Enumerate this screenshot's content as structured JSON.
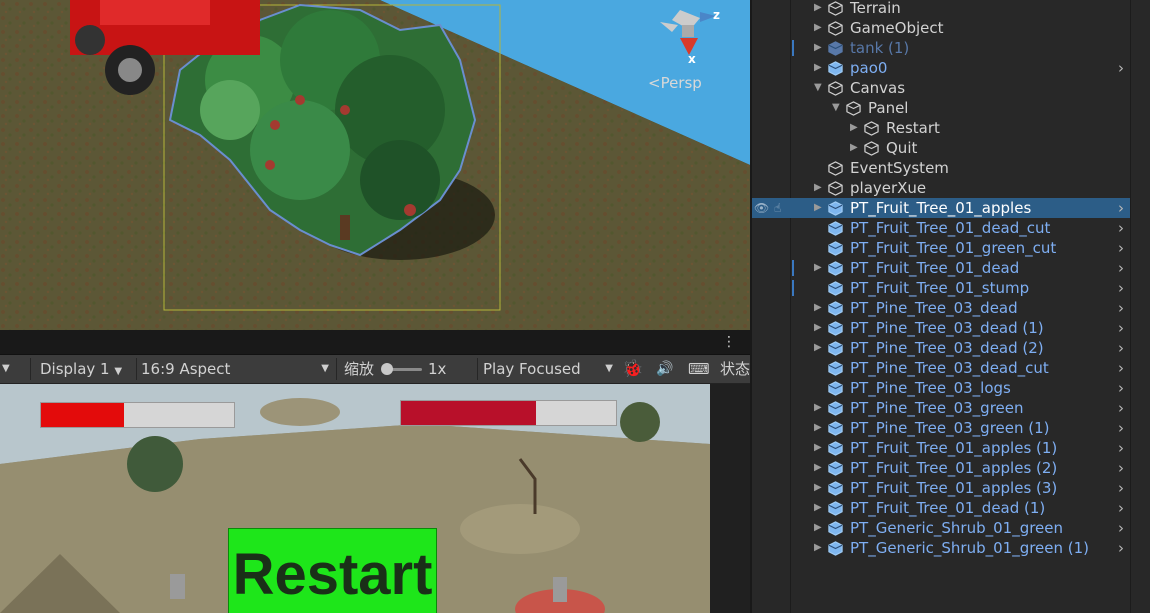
{
  "scene": {
    "view_label": "<Persp",
    "gizmo_x": "x",
    "gizmo_z": "z"
  },
  "game_toolbar": {
    "display": "Display 1",
    "aspect": "16:9 Aspect",
    "scale_label": "缩放",
    "scale_value": "1x",
    "play_mode": "Play Focused",
    "stats_label": "状态"
  },
  "game_view": {
    "restart_label": "Restart",
    "health_left_fraction": 0.43,
    "health_right_fraction": 0.63,
    "health_left_color": "#e30b0b",
    "health_right_color": "#b8102a"
  },
  "hierarchy": {
    "rows": [
      {
        "label": "Terrain",
        "style": "normal",
        "arrow": "right"
      },
      {
        "label": "GameObject",
        "style": "normal",
        "arrow": "right"
      },
      {
        "label": "tank (1)",
        "style": "dim",
        "arrow": "right"
      },
      {
        "label": "pao0",
        "style": "blue",
        "arrow": "right"
      },
      {
        "label": "Canvas",
        "style": "normal",
        "arrow": "down"
      },
      {
        "label": "Panel",
        "style": "normal",
        "arrow": "down"
      },
      {
        "label": "Restart",
        "style": "normal",
        "arrow": "right"
      },
      {
        "label": "Quit",
        "style": "normal",
        "arrow": "right"
      },
      {
        "label": "EventSystem",
        "style": "normal",
        "arrow": "none"
      },
      {
        "label": "playerXue",
        "style": "normal",
        "arrow": "right"
      },
      {
        "label": "PT_Fruit_Tree_01_apples",
        "style": "selected",
        "arrow": "right"
      },
      {
        "label": "PT_Fruit_Tree_01_dead_cut",
        "style": "blue",
        "arrow": "none"
      },
      {
        "label": "PT_Fruit_Tree_01_green_cut",
        "style": "blue",
        "arrow": "none"
      },
      {
        "label": "PT_Fruit_Tree_01_dead",
        "style": "blue",
        "arrow": "right"
      },
      {
        "label": "PT_Fruit_Tree_01_stump",
        "style": "blue",
        "arrow": "none"
      },
      {
        "label": "PT_Pine_Tree_03_dead",
        "style": "blue",
        "arrow": "right"
      },
      {
        "label": "PT_Pine_Tree_03_dead (1)",
        "style": "blue",
        "arrow": "right"
      },
      {
        "label": "PT_Pine_Tree_03_dead (2)",
        "style": "blue",
        "arrow": "right"
      },
      {
        "label": "PT_Pine_Tree_03_dead_cut",
        "style": "blue",
        "arrow": "none"
      },
      {
        "label": "PT_Pine_Tree_03_logs",
        "style": "blue",
        "arrow": "none"
      },
      {
        "label": "PT_Pine_Tree_03_green",
        "style": "blue",
        "arrow": "right"
      },
      {
        "label": "PT_Pine_Tree_03_green (1)",
        "style": "blue",
        "arrow": "right"
      },
      {
        "label": "PT_Fruit_Tree_01_apples (1)",
        "style": "blue",
        "arrow": "right"
      },
      {
        "label": "PT_Fruit_Tree_01_apples (2)",
        "style": "blue",
        "arrow": "right"
      },
      {
        "label": "PT_Fruit_Tree_01_apples (3)",
        "style": "blue",
        "arrow": "right"
      },
      {
        "label": "PT_Fruit_Tree_01_dead (1)",
        "style": "blue",
        "arrow": "right"
      },
      {
        "label": "PT_Generic_Shrub_01_green",
        "style": "blue",
        "arrow": "right"
      },
      {
        "label": "PT_Generic_Shrub_01_green (1)",
        "style": "blue",
        "arrow": "right"
      }
    ]
  }
}
